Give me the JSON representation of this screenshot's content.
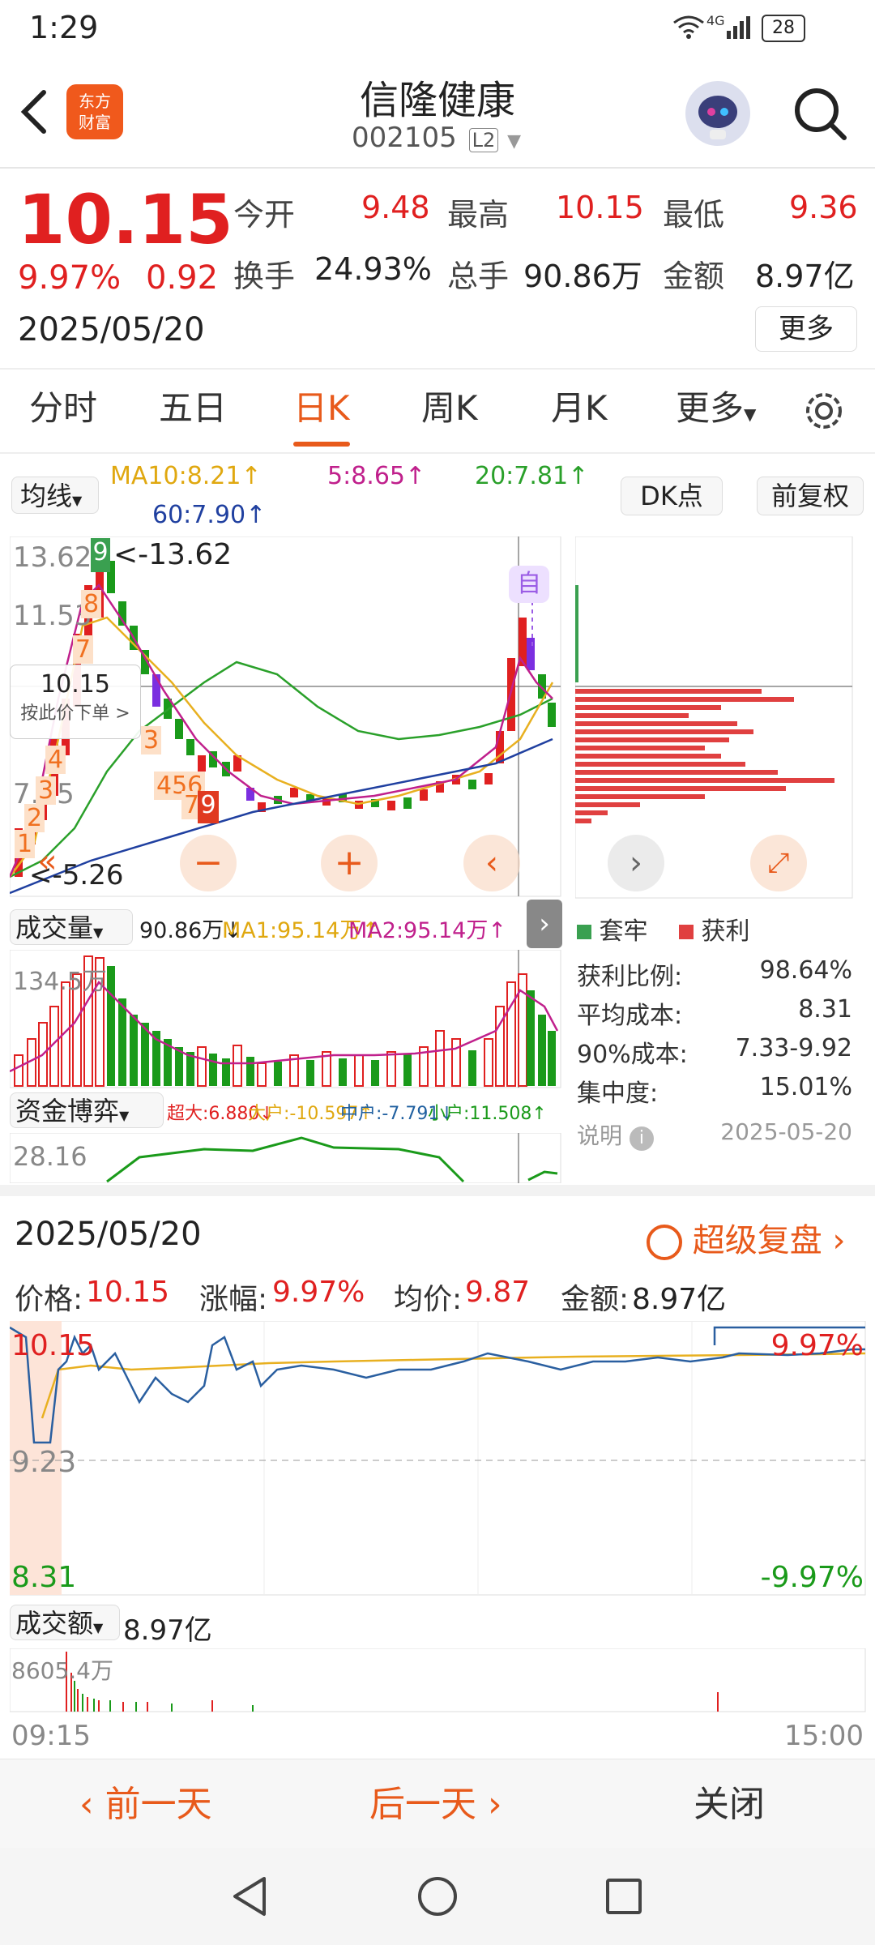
{
  "status_bar": {
    "time": "1:29",
    "network": "4G",
    "battery": "28"
  },
  "header": {
    "title": "信隆健康",
    "code": "002105",
    "level_badge": "L2",
    "logo_line1": "东方",
    "logo_line2": "财富"
  },
  "quote": {
    "price": "10.15",
    "change_pct": "9.97%",
    "change_amt": "0.92",
    "date": "2025/05/20",
    "open_label": "今开",
    "open": "9.48",
    "high_label": "最高",
    "high": "10.15",
    "low_label": "最低",
    "low": "9.36",
    "turnover_label": "换手",
    "turnover": "24.93%",
    "volume_label": "总手",
    "volume": "90.86万",
    "amount_label": "金额",
    "amount": "8.97亿",
    "more_label": "更多"
  },
  "tabs": [
    "分时",
    "五日",
    "日K",
    "周K",
    "月K",
    "更多"
  ],
  "kline": {
    "ma_selector": "均线",
    "ma10": "MA10:8.21↑",
    "ma5": "5:8.65↑",
    "ma20": "20:7.81↑",
    "ma60": "60:7.90↑",
    "dk_label": "DK点",
    "adjust_label": "前复权",
    "y_high": "13.62",
    "y_mid": "11.53",
    "y_low": "7.35",
    "y_bottom": "5.26",
    "high_marker": "<-13.62",
    "low_marker": "<-5.26",
    "order_price": "10.15",
    "order_text": "按此价下单 >",
    "self_label": "自",
    "seq_badges": [
      "9",
      "8",
      "7",
      "4",
      "3",
      "2",
      "1",
      "3",
      "456",
      "78",
      "9"
    ]
  },
  "volume_panel": {
    "selector": "成交量",
    "value": "90.86万↓",
    "ma1": "MA1:95.14万↑",
    "ma2": "MA2:95.14万↑",
    "scale": "134.5万"
  },
  "capital_panel": {
    "selector": "资金博弈",
    "super": "超大:6.880↓",
    "large": "大户:-10.597↑",
    "mid": "中户:-7.791↓",
    "small": "小户:11.508↑",
    "scale": "28.16"
  },
  "chip": {
    "legend_trapped": "套牢",
    "legend_profit": "获利",
    "rows": [
      {
        "label": "获利比例:",
        "value": "98.64%"
      },
      {
        "label": "平均成本:",
        "value": "8.31"
      },
      {
        "label": "90%成本:",
        "value": "7.33-9.92"
      },
      {
        "label": "集中度:",
        "value": "15.01%"
      }
    ],
    "note_label": "说明",
    "note_date": "2025-05-20"
  },
  "intraday": {
    "date": "2025/05/20",
    "replay_label": "超级复盘",
    "price_label": "价格:",
    "price": "10.15",
    "change_label": "涨幅:",
    "change": "9.97%",
    "avg_label": "均价:",
    "avg": "9.87",
    "amount_label": "金额:",
    "amount": "8.97亿",
    "y_top": "10.15",
    "y_mid": "9.23",
    "y_bottom": "8.31",
    "pct_top": "9.97%",
    "pct_bottom": "-9.97%",
    "vol_selector": "成交额",
    "vol_value": "8.97亿",
    "vol_scale": "8605.4万",
    "time_start": "09:15",
    "time_end": "15:00"
  },
  "bottom_actions": {
    "prev": "前一天",
    "next": "后一天",
    "close": "关闭"
  },
  "colors": {
    "up": "#e02020",
    "down": "#1a9a1a",
    "accent": "#e85a1b",
    "ma5": "#c0208c",
    "ma10": "#f0b020",
    "ma20": "#2aa02a",
    "ma60": "#2040a0"
  }
}
